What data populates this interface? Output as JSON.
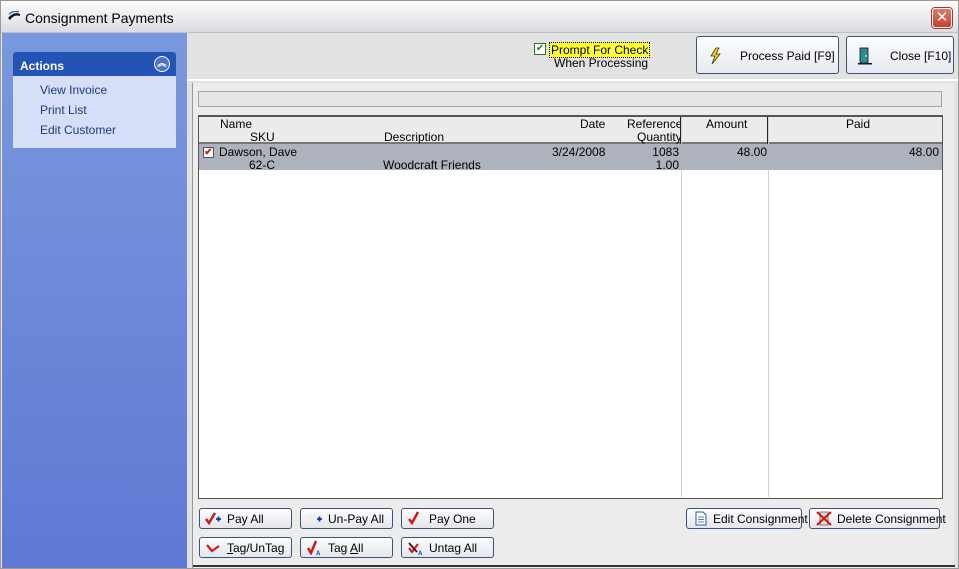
{
  "window": {
    "title": "Consignment Payments",
    "close_icon": "close-x-icon"
  },
  "sidebar": {
    "panel_title": "Actions",
    "collapse_icon": "double-chevron-up-icon",
    "items": [
      {
        "label": "View Invoice"
      },
      {
        "label": "Print List"
      },
      {
        "label": "Edit Customer"
      }
    ]
  },
  "toolbar": {
    "prompt_check": {
      "checked": true,
      "label_line1": "Prompt For Check",
      "label_line2": "When Processing"
    },
    "process_paid_label": "Process Paid [F9]",
    "close_label": "Close [F10]"
  },
  "grid": {
    "headers": {
      "name": "Name",
      "sku": "SKU",
      "description": "Description",
      "date": "Date",
      "reference": "Reference",
      "quantity": "Quantity",
      "amount": "Amount",
      "paid": "Paid"
    },
    "rows": [
      {
        "checked": true,
        "name": "Dawson, Dave",
        "sku": "62-C",
        "description": "Woodcraft Friends",
        "date": "3/24/2008",
        "reference": "1083",
        "quantity": "1.00",
        "amount": "48.00",
        "paid": "48.00"
      }
    ]
  },
  "buttons": {
    "pay_all": "Pay All",
    "unpay_all": "Un-Pay All",
    "pay_one": "Pay One",
    "tag_untag_prefix": "T",
    "tag_untag_rest": "ag/UnTag",
    "tag_all_prefix": "Tag ",
    "tag_all_ul": "A",
    "tag_all_rest": "ll",
    "untag_all": "Untag All",
    "edit_consignment": "Edit Consignment",
    "delete_consignment": "Delete Consignment"
  },
  "colors": {
    "sidebar_header": "#2353b5",
    "sidebar_bg": "#6f8bd9",
    "selected_row": "#aeb2bc",
    "highlight": "#ffff33"
  }
}
